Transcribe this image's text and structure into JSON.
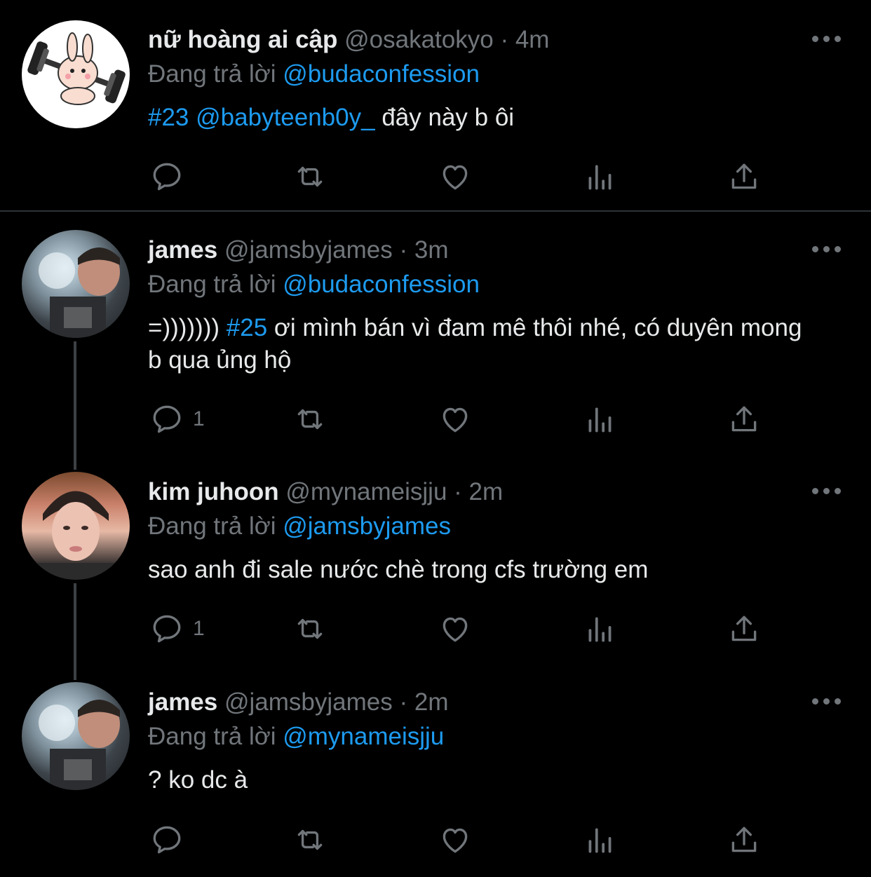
{
  "tweets": [
    {
      "name": "nữ hoàng ai cập",
      "handle": "@osakatokyo",
      "sep": "·",
      "time": "4m",
      "reply_prefix": "Đang trả lời",
      "reply_to": "@budaconfession",
      "content_parts": [
        {
          "text": "#23",
          "type": "link"
        },
        {
          "text": " ",
          "type": "text"
        },
        {
          "text": "@babyteenb0y_",
          "type": "link"
        },
        {
          "text": " đây này b ôi",
          "type": "text"
        }
      ],
      "reply_count": "",
      "avatar": "bunny-avatar"
    },
    {
      "name": "james",
      "handle": "@jamsbyjames",
      "sep": "·",
      "time": "3m",
      "reply_prefix": "Đang trả lời",
      "reply_to": "@budaconfession",
      "content_parts": [
        {
          "text": "=))))))) ",
          "type": "text"
        },
        {
          "text": "#25",
          "type": "link"
        },
        {
          "text": " ơi mình bán vì đam mê thôi nhé, có duyên mong b qua ủng hộ",
          "type": "text"
        }
      ],
      "reply_count": "1",
      "avatar": "photo-avatar"
    },
    {
      "name": "kim juhoon",
      "handle": "@mynameisjju",
      "sep": "·",
      "time": "2m",
      "reply_prefix": "Đang trả lời",
      "reply_to": "@jamsbyjames",
      "content_parts": [
        {
          "text": "sao anh đi sale nước chè trong cfs trường em",
          "type": "text"
        }
      ],
      "reply_count": "1",
      "avatar": "photo-avatar"
    },
    {
      "name": "james",
      "handle": "@jamsbyjames",
      "sep": "·",
      "time": "2m",
      "reply_prefix": "Đang trả lời",
      "reply_to": "@mynameisjju",
      "content_parts": [
        {
          "text": "? ko dc à",
          "type": "text"
        }
      ],
      "reply_count": "",
      "avatar": "photo-avatar"
    }
  ],
  "colors": {
    "background": "#000000",
    "text": "#e7e9ea",
    "muted": "#71767b",
    "accent": "#1d9bf0",
    "divider": "#2f3336"
  },
  "icons": [
    "reply-icon",
    "retweet-icon",
    "like-icon",
    "views-icon",
    "share-icon",
    "more-icon"
  ]
}
